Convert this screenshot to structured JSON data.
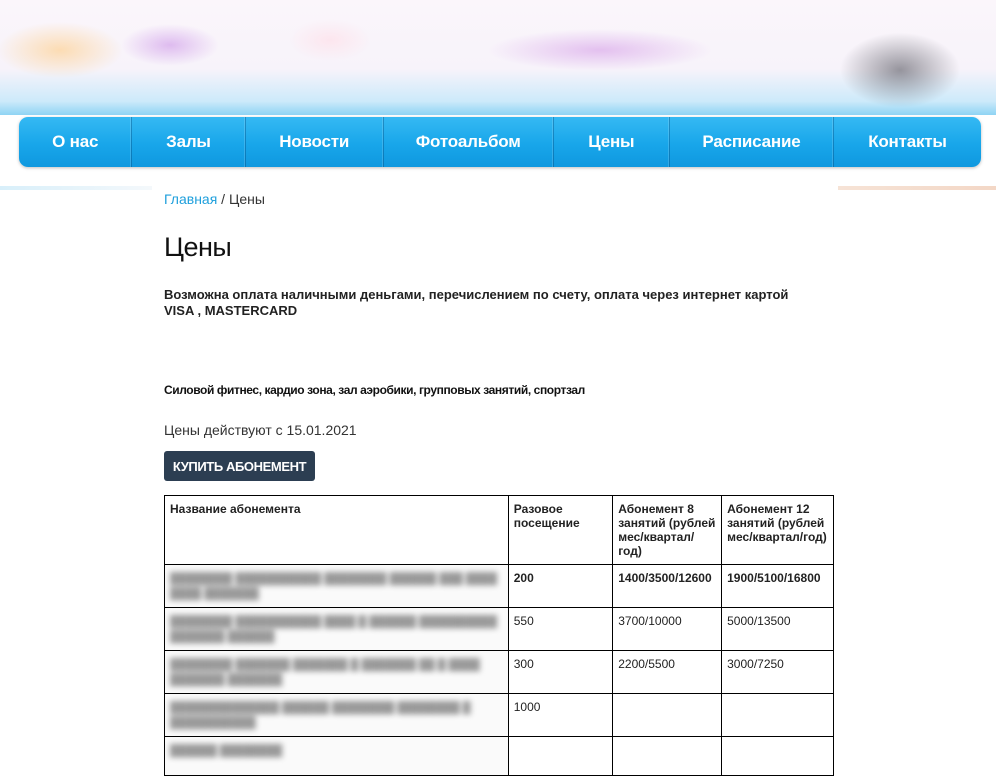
{
  "nav": {
    "items": [
      "О нас",
      "Залы",
      "Новости",
      "Фотоальбом",
      "Цены",
      "Расписание",
      "Контакты"
    ]
  },
  "breadcrumb": {
    "home": "Главная",
    "separator": " / ",
    "current": "Цены"
  },
  "page": {
    "title": "Цены",
    "payment_note": "Возможна оплата наличными деньгами, перечислением по счету, оплата через интернет картой VISA , MASTERCARD",
    "subtitle": "Силовой фитнес, кардио зона, зал аэробики, групповых занятий, спортзал",
    "valid_from": "Цены действуют с 15.01.2021",
    "buy_button": "КУПИТЬ АБОНЕМЕНТ"
  },
  "table": {
    "headers": [
      "Название абонемента",
      "Разовое посещение",
      "Абонемент 8 занятий (рублей мес/квартал/год)",
      "Абонемент 12 занятий (рублей мес/квартал/год)"
    ],
    "rows": [
      {
        "name": "",
        "single": "200",
        "eight": "1400/3500/12600",
        "twelve": "1900/5100/16800"
      },
      {
        "name": "",
        "single": "550",
        "eight": "3700/10000",
        "twelve": "5000/13500"
      },
      {
        "name": "",
        "single": "300",
        "eight": "2200/5500",
        "twelve": "3000/7250"
      },
      {
        "name": "",
        "single": "1000",
        "eight": "",
        "twelve": ""
      },
      {
        "name": "",
        "single": "",
        "eight": "",
        "twelve": ""
      }
    ]
  },
  "colors": {
    "nav_blue": "#18a6ea",
    "link_blue": "#1e9fdc",
    "button_dark": "#2c3e52"
  }
}
